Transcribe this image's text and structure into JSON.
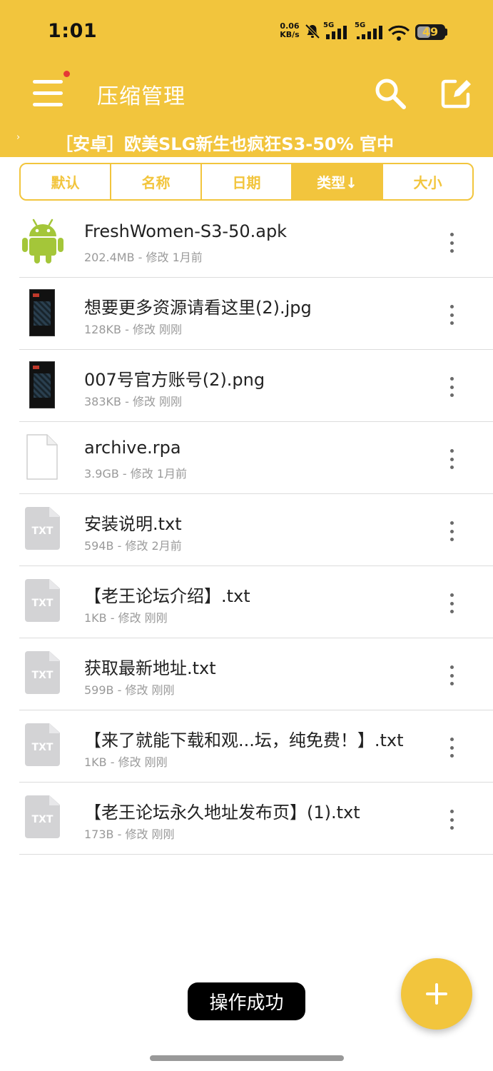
{
  "status_bar": {
    "time": "1:01",
    "net_speed_value": "0.06",
    "net_speed_unit": "KB/s",
    "sim1_label": "5G",
    "sim2_label": "5G",
    "battery": "49",
    "battery_level": 0.49
  },
  "app_bar": {
    "title": "压缩管理",
    "marquee": "［安卓］欧美SLG新生也疯狂S3-50% 官中"
  },
  "sort_tabs": [
    {
      "label": "默认",
      "active": false
    },
    {
      "label": "名称",
      "active": false
    },
    {
      "label": "日期",
      "active": false
    },
    {
      "label": "类型↓",
      "active": true
    },
    {
      "label": "大小",
      "active": false
    }
  ],
  "files": [
    {
      "name": "FreshWomen-S3-50.apk",
      "meta": "202.4MB - 修改 1月前",
      "icon": "android-icon"
    },
    {
      "name": "想要更多资源请看这里(2).jpg",
      "meta": "128KB - 修改 刚刚",
      "icon": "image-thumbnail"
    },
    {
      "name": "007号官方账号(2).png",
      "meta": "383KB - 修改 刚刚",
      "icon": "image-thumbnail"
    },
    {
      "name": "archive.rpa",
      "meta": "3.9GB - 修改 1月前",
      "icon": "blank-file-icon"
    },
    {
      "name": "安装说明.txt",
      "meta": "594B - 修改 2月前",
      "icon": "txt-file-icon"
    },
    {
      "name": "【老王论坛介绍】.txt",
      "meta": "1KB - 修改 刚刚",
      "icon": "txt-file-icon"
    },
    {
      "name": "获取最新地址.txt",
      "meta": "599B - 修改 刚刚",
      "icon": "txt-file-icon"
    },
    {
      "name": "【来了就能下载和观...坛，纯免费！】.txt",
      "meta": "1KB - 修改 刚刚",
      "icon": "txt-file-icon"
    },
    {
      "name": "【老王论坛永久地址发布页】(1).txt",
      "meta": "173B - 修改 刚刚",
      "icon": "txt-file-icon"
    }
  ],
  "txt_icon_label": "TXT",
  "toast": "操作成功",
  "colors": {
    "accent": "#f2c53d",
    "android_green": "#a4c639",
    "notification_dot": "#e53935"
  }
}
